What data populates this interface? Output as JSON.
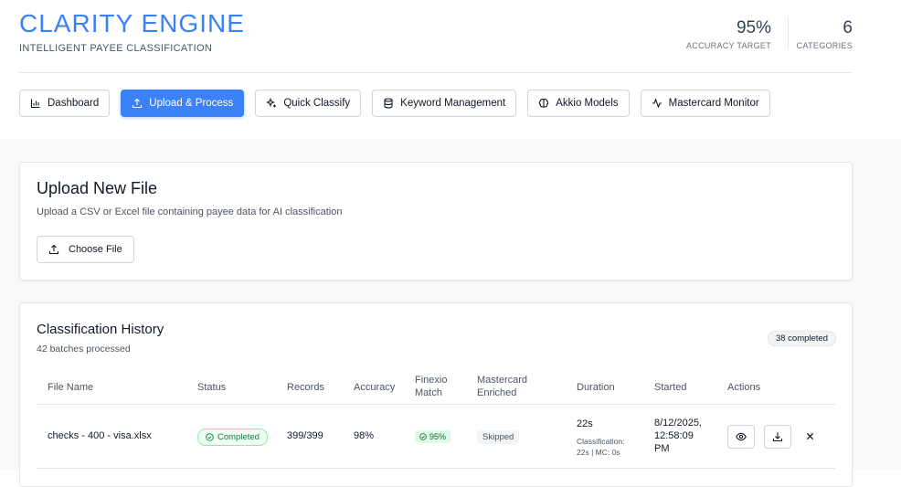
{
  "brand": {
    "title": "CLARITY ENGINE",
    "subtitle": "INTELLIGENT PAYEE CLASSIFICATION"
  },
  "stats": {
    "accuracy_value": "95%",
    "accuracy_label": "ACCURACY TARGET",
    "categories_value": "6",
    "categories_label": "CATEGORIES"
  },
  "nav": [
    {
      "label": "Dashboard",
      "icon": "bar-chart-icon",
      "active": false
    },
    {
      "label": "Upload & Process",
      "icon": "upload-icon",
      "active": true
    },
    {
      "label": "Quick Classify",
      "icon": "sparkles-icon",
      "active": false
    },
    {
      "label": "Keyword Management",
      "icon": "database-icon",
      "active": false
    },
    {
      "label": "Akkio Models",
      "icon": "brain-icon",
      "active": false
    },
    {
      "label": "Mastercard Monitor",
      "icon": "activity-icon",
      "active": false
    }
  ],
  "upload": {
    "title": "Upload New File",
    "description": "Upload a CSV or Excel file containing payee data for AI classification",
    "button_label": "Choose File"
  },
  "history": {
    "title": "Classification History",
    "subtitle": "42 batches processed",
    "completed_badge": "38 completed",
    "columns": {
      "file_name": "File Name",
      "status": "Status",
      "records": "Records",
      "accuracy": "Accuracy",
      "finexio_1": "Finexio",
      "finexio_2": "Match",
      "mastercard_1": "Mastercard",
      "mastercard_2": "Enriched",
      "duration": "Duration",
      "started": "Started",
      "actions": "Actions"
    },
    "rows": [
      {
        "file_name": "checks - 400 - visa.xlsx",
        "status": "Completed",
        "records": "399/399",
        "accuracy": "98%",
        "finexio_match": "95%",
        "mastercard": "Skipped",
        "duration": "22s",
        "duration_detail_1": "Classification:",
        "duration_detail_2": "22s | MC: 0s",
        "started_1": "8/12/2025,",
        "started_2": "12:58:09",
        "started_3": "PM"
      }
    ]
  },
  "colors": {
    "accent": "#3b82f6",
    "success": "#15803d",
    "page_bg": "#f8f9fa"
  }
}
